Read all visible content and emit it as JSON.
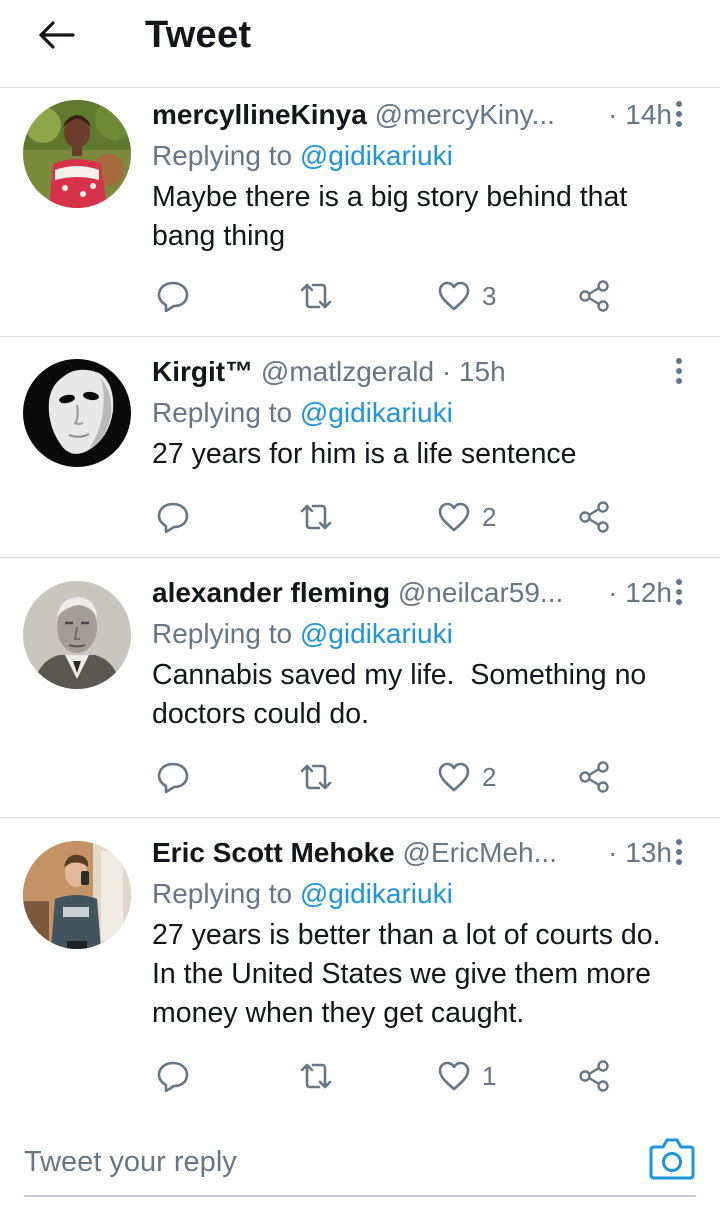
{
  "header": {
    "title": "Tweet",
    "back_icon": "arrow-left-icon"
  },
  "colors": {
    "accent": "#1b95e0",
    "secondary_text": "#657786",
    "primary_text": "#14171a",
    "divider": "#d9dde1"
  },
  "tweets": [
    {
      "display_name": "mercyllineKinya",
      "handle": "@mercyKiny...",
      "separator": "·",
      "time": "14h",
      "replying_prefix": "Replying to ",
      "replying_to": "@gidikariuki",
      "text": "Maybe there is a big story behind that bang thing",
      "like_count": "3",
      "avatar": "photo of woman in red and white top"
    },
    {
      "display_name": "Kirgit™",
      "handle": "@matlzgerald",
      "separator": "·",
      "time": "15h",
      "replying_prefix": "Replying to ",
      "replying_to": "@gidikariuki",
      "text": "27 years for him is a life sentence",
      "like_count": "2",
      "avatar": "white mask on black background"
    },
    {
      "display_name": "alexander fleming",
      "handle": "@neilcar59...",
      "separator": "·",
      "time": "12h",
      "replying_prefix": "Replying to ",
      "replying_to": "@gidikariuki",
      "text": "Cannabis saved my life.  Something no doctors could do.",
      "like_count": "2",
      "avatar": "black and white portrait of older man"
    },
    {
      "display_name": "Eric Scott Mehoke",
      "handle": "@EricMeh...",
      "separator": "·",
      "time": "13h",
      "replying_prefix": "Replying to ",
      "replying_to": "@gidikariuki",
      "text": "27 years is better than a lot of courts do. In the United States we give them more money when they get caught.",
      "like_count": "1",
      "avatar": "mirror selfie of man in t-shirt"
    }
  ],
  "action_icons": [
    "reply-icon",
    "retweet-icon",
    "like-icon",
    "share-icon"
  ],
  "composer": {
    "placeholder": "Tweet your reply",
    "camera_icon": "camera-icon"
  }
}
